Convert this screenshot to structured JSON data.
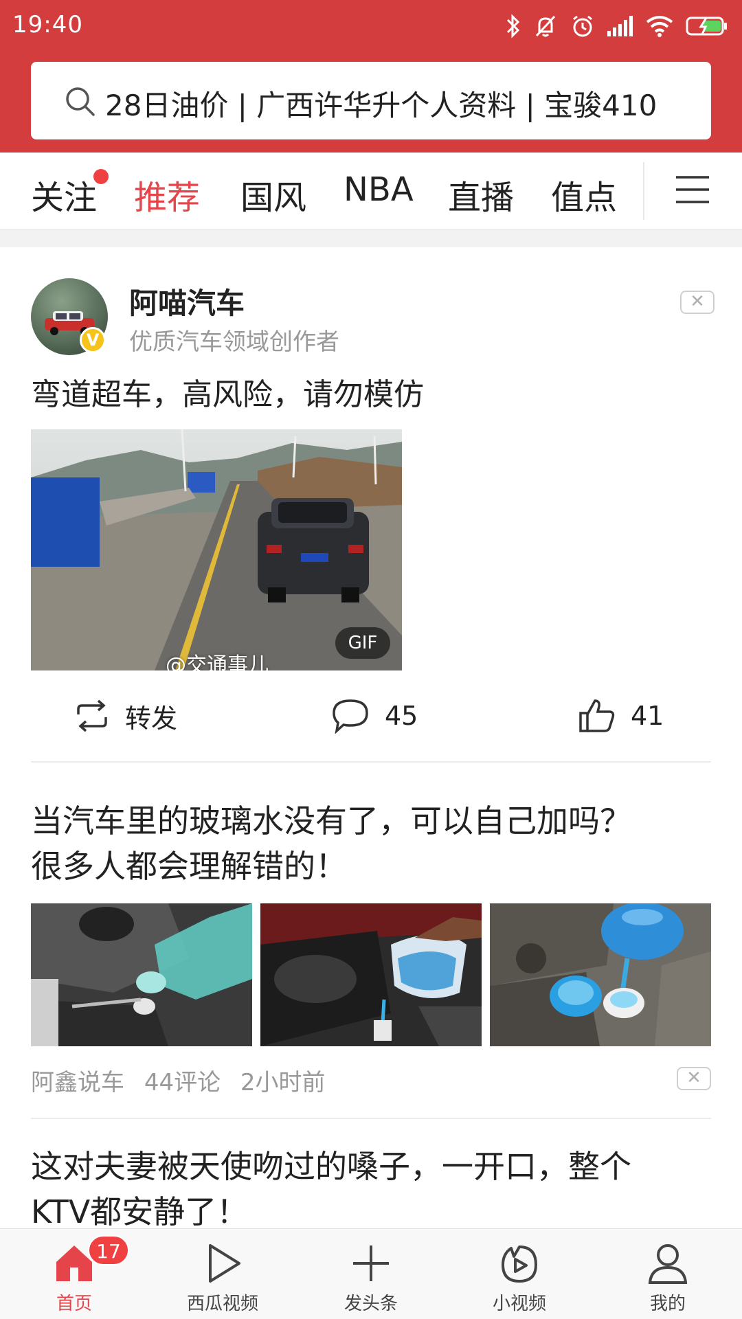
{
  "status_bar": {
    "time": "19:40"
  },
  "search": {
    "query": "28日油价 | 广西许华升个人资料 | 宝骏410"
  },
  "tabs": [
    {
      "label": "关注",
      "active": false,
      "has_dot": true
    },
    {
      "label": "推荐",
      "active": true
    },
    {
      "label": "国风",
      "active": false
    },
    {
      "label": "NBA",
      "active": false
    },
    {
      "label": "直播",
      "active": false
    },
    {
      "label": "值点",
      "active": false
    }
  ],
  "colors": {
    "brand_red": "#d43d3d",
    "active_tab": "#e5454a",
    "badge_red": "#f04142",
    "verified_yellow": "#f6c31b"
  },
  "post": {
    "author_name": "阿喵汽车",
    "author_desc": "优质汽车领域创作者",
    "verified_mark": "V",
    "text": "弯道超车，高风险，请勿模仿",
    "media_watermark": "@交通事儿",
    "media_badge": "GIF",
    "actions": {
      "repost_label": "转发",
      "comment_count": "45",
      "like_count": "41"
    },
    "dismiss_icon": "close-icon"
  },
  "article1": {
    "title_line1": "当汽车里的玻璃水没有了，可以自己加吗？",
    "title_line2": "很多人都会理解错的！",
    "source": "阿鑫说车",
    "comments": "44评论",
    "time": "2小时前"
  },
  "article2": {
    "title_line1": "这对夫妻被天使吻过的嗓子，一开口，整个",
    "title_line2": "KTV都安静了！"
  },
  "bottom_nav": {
    "home_label": "首页",
    "home_badge": "17",
    "video_label": "西瓜视频",
    "post_label": "发头条",
    "short_video_label": "小视频",
    "me_label": "我的"
  }
}
